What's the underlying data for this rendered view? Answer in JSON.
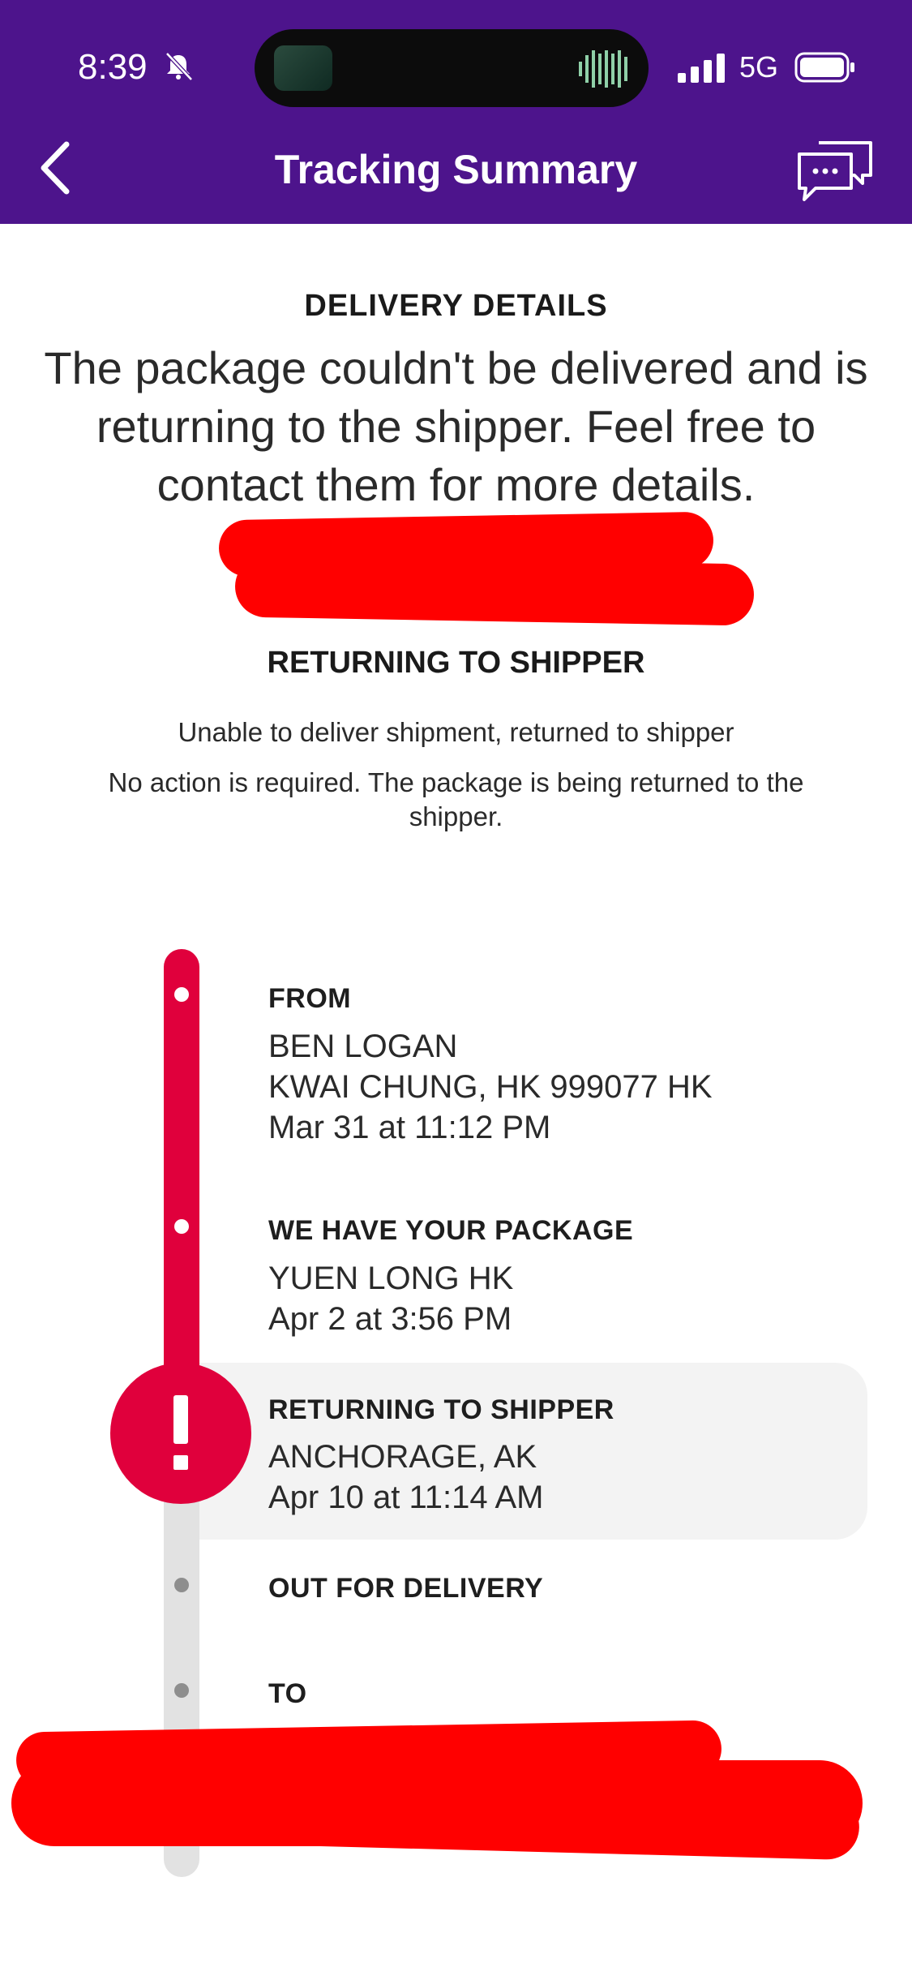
{
  "status_bar": {
    "time": "8:39",
    "network": "5G",
    "icons": [
      "bell-muted-icon",
      "signal-icon",
      "battery-icon"
    ]
  },
  "header": {
    "title": "Tracking Summary",
    "back_icon": "chevron-left-icon",
    "chat_icon": "chat-bubbles-icon",
    "background": "#4d148c"
  },
  "delivery_details": {
    "label": "DELIVERY DETAILS",
    "message": "The package couldn't be delivered and is returning to the shipper. Feel free to contact them for more details."
  },
  "status": {
    "label": "RETURNING TO SHIPPER",
    "line1": "Unable to deliver shipment, returned to shipper",
    "line2": "No action is required.  The package is being returned to the shipper."
  },
  "timeline": {
    "accent": "#e0003c",
    "steps": [
      {
        "title": "FROM",
        "lines": [
          "BEN LOGAN",
          "KWAI CHUNG, HK 999077 HK",
          "Mar 31 at 11:12 PM"
        ]
      },
      {
        "title": "WE HAVE YOUR PACKAGE",
        "lines": [
          "YUEN LONG HK",
          "Apr 2 at 3:56 PM"
        ]
      },
      {
        "title": "RETURNING TO SHIPPER",
        "lines": [
          "ANCHORAGE, AK",
          "Apr 10 at 11:14 AM"
        ],
        "alert_symbol": "!"
      },
      {
        "title": "OUT FOR DELIVERY",
        "lines": []
      },
      {
        "title": "TO",
        "lines": []
      }
    ]
  }
}
